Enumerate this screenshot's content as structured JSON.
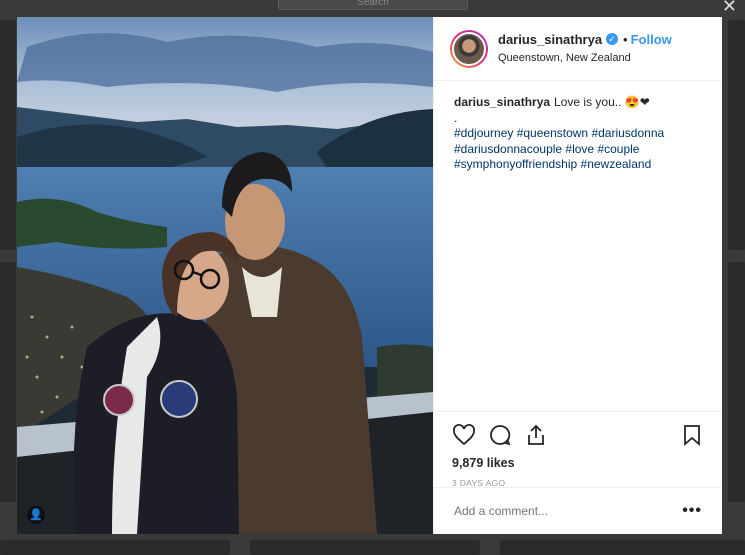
{
  "app": {
    "search_placeholder": "Search",
    "close_symbol": "✕"
  },
  "post": {
    "username": "darius_sinathrya",
    "verified_symbol": "✓",
    "follow_label": "Follow",
    "location": "Queenstown, New Zealand",
    "caption": {
      "text": "Love is you.. 😍❤",
      "line2": ".",
      "hashtags": "#ddjourney #queenstown #dariusdonna #dariusdonnacouple #love #couple #symphonyoffriendship #newzealand"
    },
    "likes": "9,879 likes",
    "timestamp": "3 DAYS AGO",
    "comment_placeholder": "Add a comment...",
    "more_symbol": "•••",
    "tag_badge_symbol": "👤"
  },
  "icons": [
    "heart-icon",
    "comment-icon",
    "share-icon",
    "bookmark-icon",
    "more-options-icon",
    "tagged-people-icon",
    "verified-badge-icon"
  ],
  "colors": {
    "link_blue": "#3897f0",
    "hashtag": "#003569",
    "text": "#262626",
    "muted": "#999999"
  }
}
